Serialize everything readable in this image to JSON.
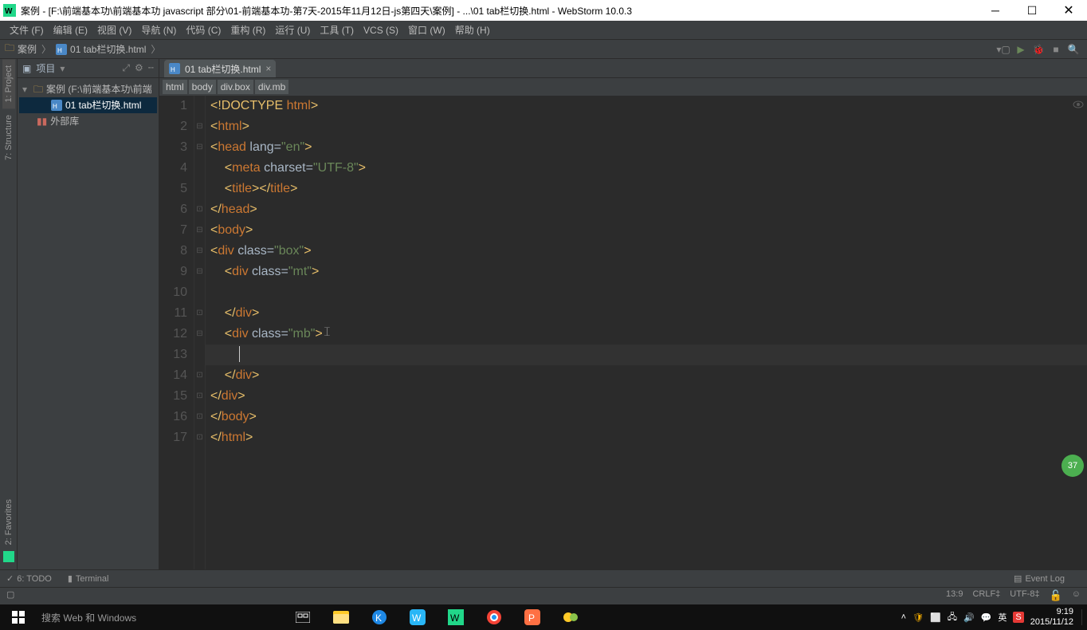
{
  "titlebar": {
    "text": "案例 - [F:\\前端基本功\\前端基本功 javascript 部分\\01-前端基本功-第7天-2015年11月12日-js第四天\\案例] - ...\\01 tab栏切换.html - WebStorm 10.0.3"
  },
  "menu": [
    "文件 (F)",
    "编辑 (E)",
    "视图 (V)",
    "导航 (N)",
    "代码 (C)",
    "重构 (R)",
    "运行 (U)",
    "工具 (T)",
    "VCS (S)",
    "窗口 (W)",
    "帮助 (H)"
  ],
  "nav": {
    "crumb1_icon": "folder",
    "crumb1": "案例",
    "crumb2": "01 tab栏切换.html"
  },
  "left_tabs": {
    "project": "1: Project",
    "structure": "7: Structure",
    "favorites": "2: Favorites"
  },
  "project_panel": {
    "header": "项目",
    "root": "案例 (F:\\前端基本功\\前端",
    "file": "01 tab栏切换.html",
    "external": "外部库"
  },
  "editor": {
    "tab": "01 tab栏切换.html",
    "crumbs": [
      "html",
      "body",
      "div.box",
      "div.mb"
    ],
    "line_numbers": [
      "1",
      "2",
      "3",
      "4",
      "5",
      "6",
      "7",
      "8",
      "9",
      "10",
      "11",
      "12",
      "13",
      "14",
      "15",
      "16",
      "17"
    ]
  },
  "code": {
    "l1a": "<!DOCTYPE ",
    "l1b": "html",
    "l1c": ">",
    "l2a": "<",
    "l2b": "html",
    "l2c": ">",
    "l3a": "<",
    "l3b": "head ",
    "l3c": "lang",
    "l3d": "=",
    "l3e": "\"en\"",
    "l3f": ">",
    "l4a": "    <",
    "l4b": "meta ",
    "l4c": "charset",
    "l4d": "=",
    "l4e": "\"UTF-8\"",
    "l4f": ">",
    "l5a": "    <",
    "l5b": "title",
    "l5c": "></",
    "l5d": "title",
    "l5e": ">",
    "l6a": "</",
    "l6b": "head",
    "l6c": ">",
    "l7a": "<",
    "l7b": "body",
    "l7c": ">",
    "l8a": "<",
    "l8b": "div ",
    "l8c": "class",
    "l8d": "=",
    "l8e": "\"box\"",
    "l8f": ">",
    "l9a": "    <",
    "l9b": "div ",
    "l9c": "class",
    "l9d": "=",
    "l9e": "\"mt\"",
    "l9f": ">",
    "l10": "",
    "l11a": "    </",
    "l11b": "div",
    "l11c": ">",
    "l12a": "    <",
    "l12b": "div ",
    "l12c": "class",
    "l12d": "=",
    "l12e": "\"mb\"",
    "l12f": ">",
    "l13": "        ",
    "l14a": "    </",
    "l14b": "div",
    "l14c": ">",
    "l15a": "</",
    "l15b": "div",
    "l15c": ">",
    "l16a": "</",
    "l16b": "body",
    "l16c": ">",
    "l17a": "</",
    "l17b": "html",
    "l17c": ">"
  },
  "bottom": {
    "todo": "6: TODO",
    "terminal": "Terminal",
    "eventlog": "Event Log"
  },
  "status": {
    "pos": "13:9",
    "lineend": "CRLF‡",
    "encoding": "UTF-8‡"
  },
  "taskbar": {
    "search": "搜索 Web 和 Windows",
    "ime": "英",
    "time": "9:19",
    "date": "2015/11/12"
  },
  "badge": "37"
}
